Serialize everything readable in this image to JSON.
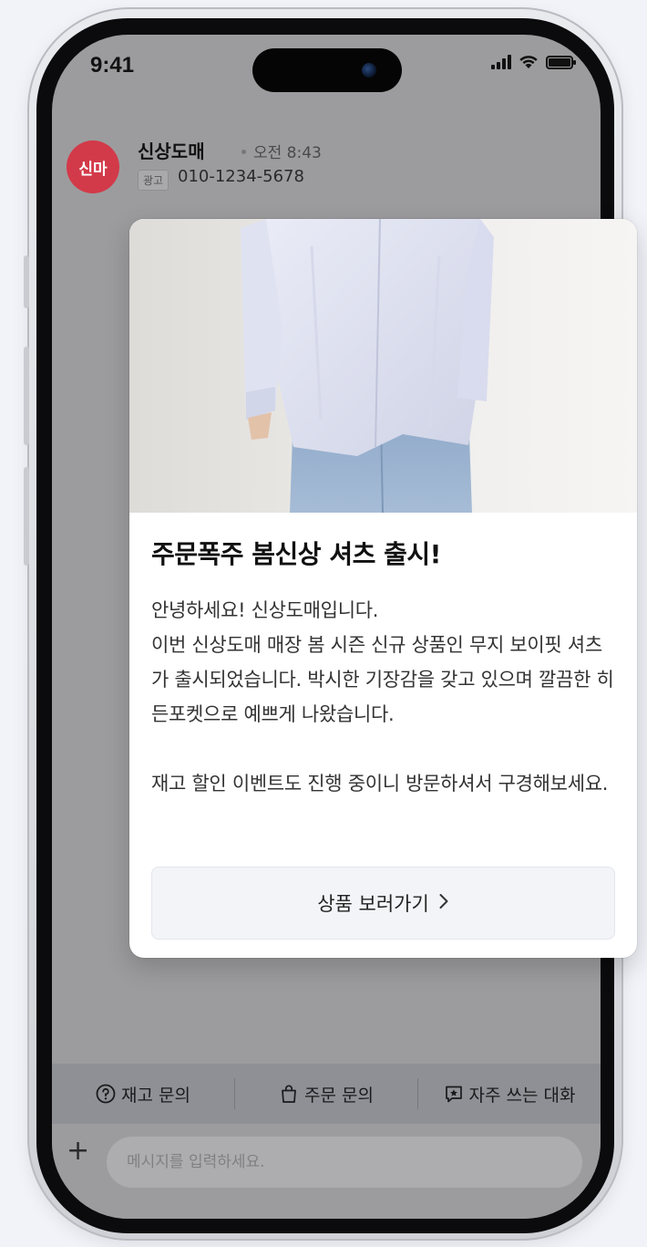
{
  "status_bar": {
    "time": "9:41"
  },
  "chat": {
    "avatar_text": "신마",
    "sender_name": "신상도매",
    "timestamp": "오전 8:43",
    "ad_badge": "광고",
    "phone_number": "010-1234-5678"
  },
  "card": {
    "title": "주문폭주 봄신상 셔츠 출시!",
    "body": "안녕하세요! 신상도매입니다.\n이번 신상도매 매장 봄 시즌 신규 상품인 무지 보이핏 셔츠가 출시되었습니다. 박시한 기장감을 갖고 있으며 깔끔한 히든포켓으로 예쁘게 나왔습니다.\n\n재고 할인 이벤트도 진행 중이니 방문하셔서 구경해보세요.",
    "button_label": "상품 보러가기",
    "button_icon": "chevron-right-icon"
  },
  "quick_actions": [
    {
      "label": "재고 문의",
      "icon": "question-circle-icon"
    },
    {
      "label": "주문 문의",
      "icon": "shopping-bag-icon"
    },
    {
      "label": "자주 쓰는 대화",
      "icon": "star-message-icon"
    }
  ],
  "input": {
    "placeholder": "메시지를 입력하세요."
  },
  "colors": {
    "avatar": "#d23a49",
    "dim_overlay": "#9c9c9e",
    "card_bg": "#ffffff"
  }
}
